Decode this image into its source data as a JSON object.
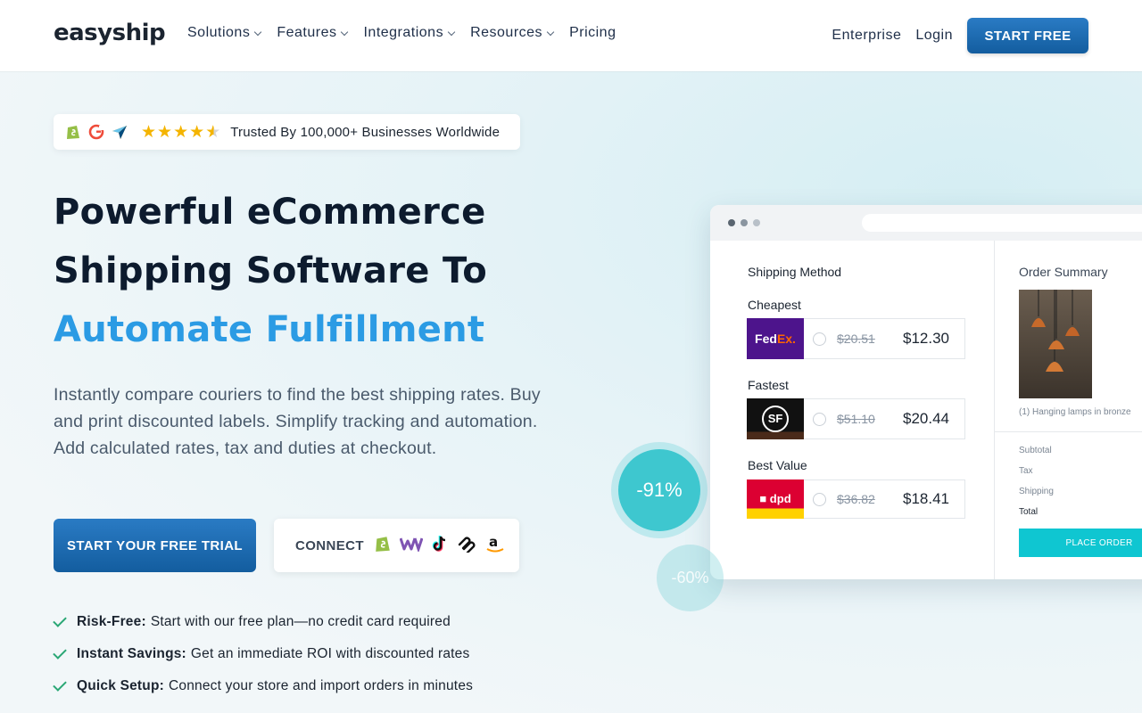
{
  "nav": {
    "logo": "easyship",
    "menu": [
      {
        "label": "Solutions"
      },
      {
        "label": "Features"
      },
      {
        "label": "Integrations"
      },
      {
        "label": "Resources"
      },
      {
        "label": "Pricing"
      }
    ],
    "enterprise": "Enterprise",
    "login": "Login",
    "cta": "START FREE"
  },
  "trust": {
    "icons": [
      "shopify-icon",
      "g2-icon",
      "capterra-icon"
    ],
    "rating_stars": 4.5,
    "text": "Trusted By 100,000+ Businesses Worldwide"
  },
  "hero": {
    "line1": "Powerful eCommerce",
    "line2": "Shipping Software To",
    "line3": "Automate Fulfillment",
    "description": "Instantly compare couriers to find the best shipping rates. Buy and print discounted labels. Simplify tracking and automation. Add calculated rates, tax and duties at checkout.",
    "cta_trial": "START YOUR FREE TRIAL",
    "connect_label": "CONNECT",
    "connect_icons": [
      "shopify-icon",
      "woocommerce-icon",
      "tiktok-icon",
      "squarespace-icon",
      "amazon-icon"
    ]
  },
  "bullets": [
    {
      "title": "Risk-Free:",
      "text": "Start with our free plan—no credit card required"
    },
    {
      "title": "Instant Savings:",
      "text": "Get an immediate ROI with discounted rates"
    },
    {
      "title": "Quick Setup:",
      "text": "Connect your store and import orders in minutes"
    }
  ],
  "mock": {
    "shipping_title": "Shipping Method",
    "rates": [
      {
        "category": "Cheapest",
        "carrier": "FedEx",
        "old": "$20.51",
        "new": "$12.30"
      },
      {
        "category": "Fastest",
        "carrier": "SF",
        "old": "$51.10",
        "new": "$20.44"
      },
      {
        "category": "Best Value",
        "carrier": "dpd",
        "old": "$36.82",
        "new": "$18.41"
      }
    ],
    "summary_title": "Order Summary",
    "item_caption": "(1) Hanging lamps in bronze",
    "subtotal": "Subtotal",
    "tax": "Tax",
    "shipping": "Shipping",
    "total": "Total",
    "place_order": "PLACE ORDER"
  },
  "badges": {
    "big": "-91%",
    "small": "-60%"
  },
  "colors": {
    "accent": "#2b9be4",
    "button": "#1a6db3",
    "check": "#2aa775",
    "teal": "#3ec7cf"
  }
}
